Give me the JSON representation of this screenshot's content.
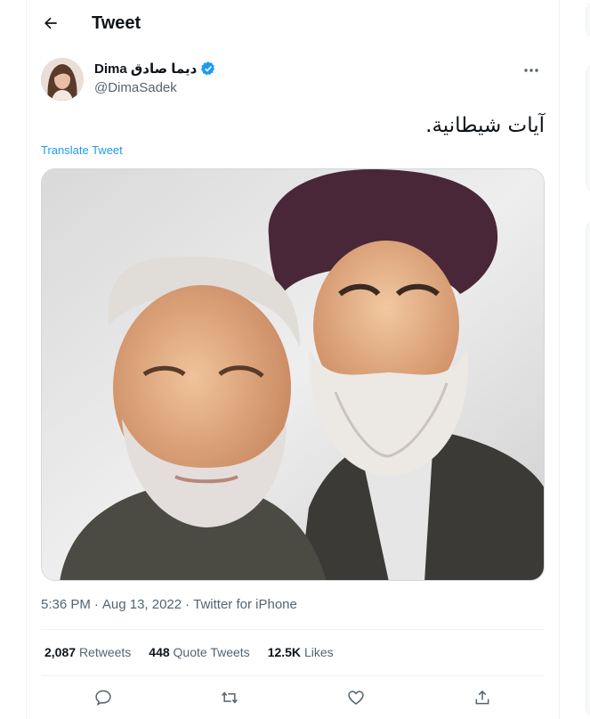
{
  "header": {
    "title": "Tweet",
    "back_icon": "arrow-left-icon"
  },
  "author": {
    "display_name": "Dima ديما صادق",
    "handle": "@DimaSadek",
    "verified_color": "#1d9bf0",
    "more_icon": "more-horizontal-icon"
  },
  "tweet": {
    "text": "آيات شيطانية.",
    "translate_label": "Translate Tweet",
    "time": "5:36 PM",
    "date": "Aug 13, 2022",
    "source": "Twitter for iPhone"
  },
  "stats": {
    "retweets_count": "2,087",
    "retweets_label": "Retweets",
    "quotes_count": "448",
    "quotes_label": "Quote Tweets",
    "likes_count": "12.5K",
    "likes_label": "Likes"
  },
  "actions": [
    "reply-icon",
    "retweet-icon",
    "like-icon",
    "share-icon"
  ],
  "colors": {
    "accent": "#1d9bf0",
    "secondary_text": "#536471",
    "border": "#eff3f4"
  }
}
